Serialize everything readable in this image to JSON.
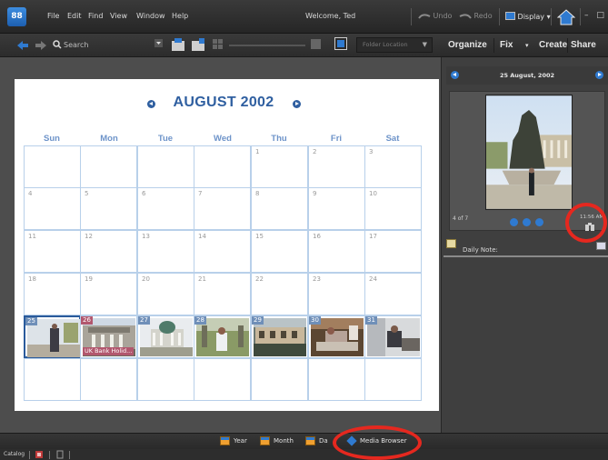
{
  "menubar": {
    "items": [
      "File",
      "Edit",
      "Find",
      "View",
      "Window",
      "Help"
    ],
    "welcome": "Welcome, Ted",
    "undo": "Undo",
    "redo": "Redo",
    "display": "Display",
    "window_controls": "– □"
  },
  "toolbar": {
    "search_label": "Search",
    "folder_location": "Folder Location"
  },
  "tabs": [
    "Organize",
    "Fix",
    "Create",
    "Share"
  ],
  "calendar": {
    "title": "AUGUST 2002",
    "weekdays": [
      "Sun",
      "Mon",
      "Tue",
      "Wed",
      "Thu",
      "Fri",
      "Sat"
    ],
    "holiday_label": "UK Bank Holid...",
    "colors": {
      "accent": "#2f5fa0",
      "grid": "#b8d0ea",
      "holiday": "#b2576e"
    }
  },
  "right_panel": {
    "date": "25 August, 2002",
    "photo_count": "4 of 7",
    "time": "11:56 AM",
    "daily_note": "Daily Note:"
  },
  "view_bar": {
    "year": "Year",
    "month": "Month",
    "day": "Da",
    "media_browser": "Media Browser"
  },
  "status_bar": {
    "catalog": "Catalog"
  },
  "annotation_color": "#e5281f"
}
